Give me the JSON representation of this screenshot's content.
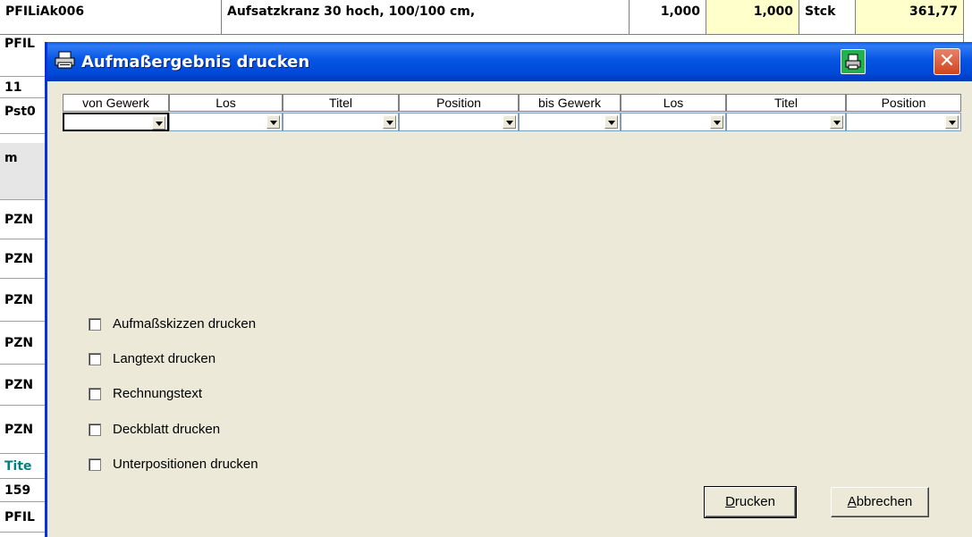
{
  "background": {
    "top_row": {
      "code": "PFILiAk006",
      "description": "Aufsatzkranz 30 hoch, 100/100 cm,",
      "qty1": "1,000",
      "qty2": "1,000",
      "unit": "Stck",
      "price": "361,77"
    },
    "left_cells": [
      "PFIL",
      "11",
      "Pst0",
      "m",
      "PZN",
      "PZN",
      "PZN",
      "PZN",
      "PZN",
      "PZN",
      "Tite",
      "159",
      "PFIL"
    ]
  },
  "dialog": {
    "title": "Aufmaßergebnis drucken",
    "columns": [
      "von Gewerk",
      "Los",
      "Titel",
      "Position",
      "bis Gewerk",
      "Los",
      "Titel",
      "Position"
    ],
    "checkboxes": [
      {
        "label": "Aufmaßskizzen drucken",
        "checked": false
      },
      {
        "label": "Langtext drucken",
        "checked": false
      },
      {
        "label": "Rechnungstext",
        "checked": false
      },
      {
        "label": "Deckblatt drucken",
        "checked": false
      },
      {
        "label": "Unterpositionen drucken",
        "checked": false
      }
    ],
    "buttons": {
      "print_label": "Drucken",
      "print_mnemonic": "D",
      "print_rest": "rucken",
      "cancel_mnemonic": "A",
      "cancel_rest": "bbrechen"
    }
  },
  "colors": {
    "titlebar": "#0554e3",
    "dialog_bg": "#ece9d8",
    "highlight_cell": "#ffffcc",
    "teal_text": "#008080"
  }
}
